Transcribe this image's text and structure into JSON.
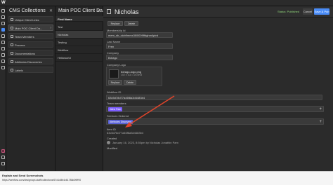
{
  "app": {
    "logo": "W"
  },
  "collections_panel": {
    "title": "CMS Collections",
    "items": [
      {
        "label": "Unique Client Links",
        "count": "3"
      },
      {
        "label": "Main POC Client Da...",
        "count": "4",
        "selected": true
      },
      {
        "label": "Team Members",
        "count": "1"
      },
      {
        "label": "Process",
        "count": "4"
      },
      {
        "label": "Documentations",
        "count": "4"
      },
      {
        "label": "Attributes Discoveries",
        "count": "5"
      },
      {
        "label": "Labels",
        "count": "6"
      }
    ]
  },
  "items_panel": {
    "title": "Main POC Client Da...",
    "column_header": "First Name",
    "rows": [
      {
        "label": "Test"
      },
      {
        "label": "Nicholas",
        "selected": true
      },
      {
        "label": "Testing"
      },
      {
        "label": "Webflow"
      },
      {
        "label": "Helloworld"
      }
    ]
  },
  "detail": {
    "title": "Nicholas",
    "status": "Status: Published",
    "cancel": "Cancel",
    "save": "Save & Pub",
    "top_image": {
      "replace": "Replace",
      "delete": "Delete"
    },
    "fields": {
      "membership_label": "Membership Id",
      "membership_value": "mem_sb_clcb9mmx3l00009ffdghm4ptrd",
      "last_name_label": "Last Name",
      "last_name_value": "Fren",
      "company_label": "Company",
      "company_value": "Bdrago",
      "logo_label": "Company Logo",
      "logo_name": "bdrago-logo.png",
      "logo_meta": "102 x 102 • 25.5KB",
      "logo_replace": "Replace",
      "logo_delete": "Delete",
      "webflow_label": "Webflow ID",
      "webflow_value": "63c5d78d77a46f8a3d4483b4",
      "team_label": "Team members",
      "team_tag": "Jeinz Pam",
      "services_label": "Services Ordered",
      "services_tag": "Attributes Discovery",
      "item_id_label": "Item ID",
      "item_id_value": "63c5d78d77a46f8a3d4483b4",
      "created_label": "Created",
      "created_value": "January 16, 2023, 8:50pm by Nicholas Jonathin Pam",
      "modified_label": "Modified"
    }
  },
  "footer": {
    "title": "Explain and Send Screenshots",
    "url": "https://webflow.com/design/cpt-staff/collections/67d1d8b4c61788d09ff90"
  },
  "colors": {
    "accent": "#4a8cf7",
    "tag": "#7b5cff",
    "arrow": "#e0442a"
  }
}
